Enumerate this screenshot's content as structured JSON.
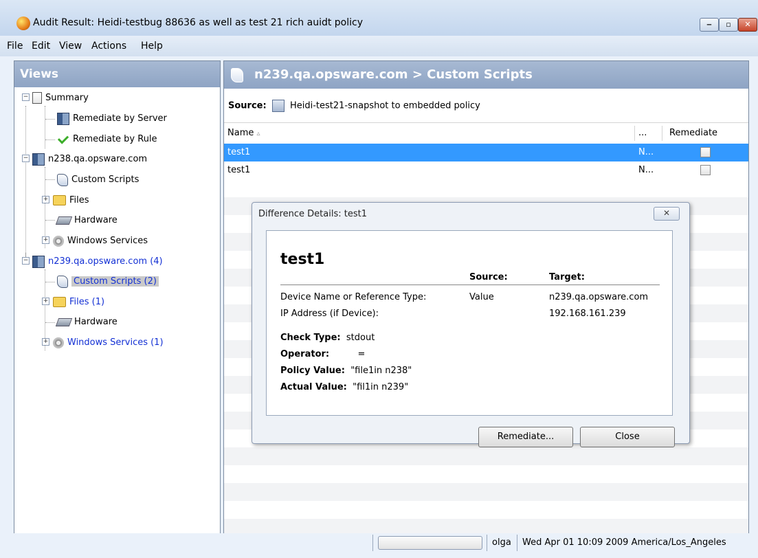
{
  "window": {
    "title": "Audit Result: Heidi-testbug 88636 as well as test 21 rich auidt policy"
  },
  "menu": [
    "File",
    "Edit",
    "View",
    "Actions",
    "Help"
  ],
  "views": {
    "header": "Views",
    "tree": {
      "summary": "Summary",
      "remediate_by_server": "Remediate by Server",
      "remediate_by_rule": "Remediate by Rule",
      "server1": "n238.qa.opsware.com",
      "server1_children": [
        "Custom Scripts",
        "Files",
        "Hardware",
        "Windows Services"
      ],
      "server2": "n239.qa.opsware.com (4)",
      "server2_children": [
        "Custom Scripts (2)",
        "Files (1)",
        "Hardware",
        "Windows Services (1)"
      ]
    }
  },
  "main": {
    "header": "n239.qa.opsware.com > Custom Scripts",
    "source_label": "Source:",
    "source_value": "Heidi-test21-snapshot to embedded policy",
    "columns": [
      "Name",
      "...",
      "Remediate"
    ],
    "sort_indicator": "▵",
    "rows": [
      {
        "name": "test1",
        "col2": "N...",
        "remediate": false
      },
      {
        "name": "test1",
        "col2": "N...",
        "remediate": false
      }
    ]
  },
  "dialog": {
    "title": "Difference Details: test1",
    "close_glyph": "✕",
    "heading": "test1",
    "col_source": "Source:",
    "col_target": "Target:",
    "rows": [
      {
        "label": "Device Name or Reference Type:",
        "source": "Value",
        "target": "n239.qa.opsware.com"
      },
      {
        "label": "IP Address (if Device):",
        "source": "",
        "target": "192.168.161.239"
      }
    ],
    "details": [
      {
        "label": "Check Type:",
        "value": "stdout"
      },
      {
        "label": "Operator:",
        "value": "="
      },
      {
        "label": "Policy Value:",
        "value": "\"file1in n238\""
      },
      {
        "label": "Actual Value:",
        "value": "\"fil1in n239\""
      }
    ],
    "buttons": {
      "remediate": "Remediate...",
      "close": "Close"
    }
  },
  "status": {
    "user": "olga",
    "datetime": "Wed Apr 01 10:09 2009 America/Los_Angeles"
  },
  "window_controls": {
    "minimize": "‒",
    "maximize": "▫",
    "close": "✕"
  }
}
